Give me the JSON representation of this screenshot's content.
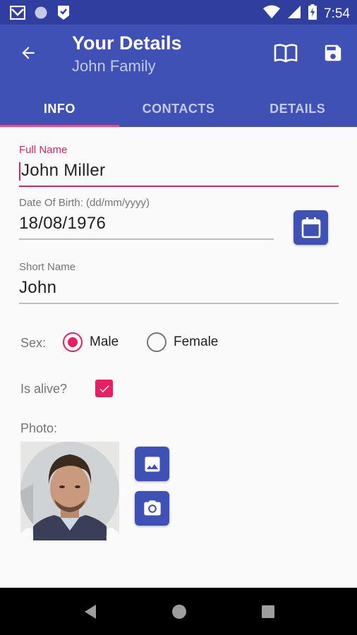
{
  "status_bar": {
    "time": "7:54",
    "icons": [
      "mail-icon",
      "circle-icon",
      "download-badge-icon",
      "wifi-icon",
      "signal-icon",
      "battery-charging-icon"
    ]
  },
  "app_bar": {
    "title": "Your Details",
    "subtitle": "John Family",
    "tabs": [
      {
        "label": "INFO",
        "active": true
      },
      {
        "label": "CONTACTS",
        "active": false
      },
      {
        "label": "DETAILS",
        "active": false
      }
    ],
    "actions": [
      "book-icon",
      "save-icon"
    ]
  },
  "form": {
    "full_name": {
      "label": "Full Name",
      "value": "John Miller"
    },
    "dob": {
      "label": "Date Of Birth: (dd/mm/yyyy)",
      "value": "18/08/1976"
    },
    "short_name": {
      "label": "Short Name",
      "value": "John"
    },
    "sex": {
      "label": "Sex:",
      "options": [
        "Male",
        "Female"
      ],
      "selected": "Male"
    },
    "alive": {
      "label": "Is alive?",
      "checked": true
    },
    "photo": {
      "label": "Photo:"
    }
  },
  "colors": {
    "primary": "#3f51b5",
    "primary_dark": "#303f9f",
    "accent": "#e91e63"
  }
}
